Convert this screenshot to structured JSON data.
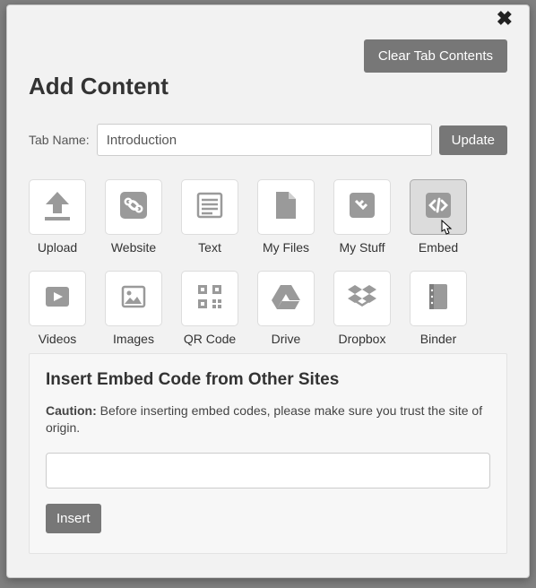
{
  "modal": {
    "title": "Add Content",
    "close_icon_name": "close-icon",
    "clear_button": "Clear Tab Contents",
    "tabname_label": "Tab Name:",
    "tabname_value": "Introduction",
    "update_button": "Update"
  },
  "tiles": [
    {
      "id": "upload",
      "label": "Upload"
    },
    {
      "id": "website",
      "label": "Website"
    },
    {
      "id": "text",
      "label": "Text"
    },
    {
      "id": "myfiles",
      "label": "My Files"
    },
    {
      "id": "mystuff",
      "label": "My Stuff"
    },
    {
      "id": "embed",
      "label": "Embed",
      "selected": true
    },
    {
      "id": "videos",
      "label": "Videos"
    },
    {
      "id": "images",
      "label": "Images"
    },
    {
      "id": "qrcode",
      "label": "QR Code"
    },
    {
      "id": "drive",
      "label": "Drive"
    },
    {
      "id": "dropbox",
      "label": "Dropbox"
    },
    {
      "id": "binder",
      "label": "Binder"
    }
  ],
  "panel": {
    "heading": "Insert Embed Code from Other Sites",
    "caution_label": "Caution:",
    "caution_text": "Before inserting embed codes, please make sure you trust the site of origin.",
    "textarea_value": "",
    "insert_button": "Insert"
  },
  "colors": {
    "button_gray": "#777777",
    "modal_bg": "#f2f2f2",
    "tile_bg": "#ffffff",
    "tile_selected_bg": "#dcdcdc",
    "icon_gray": "#9a9a9a"
  }
}
